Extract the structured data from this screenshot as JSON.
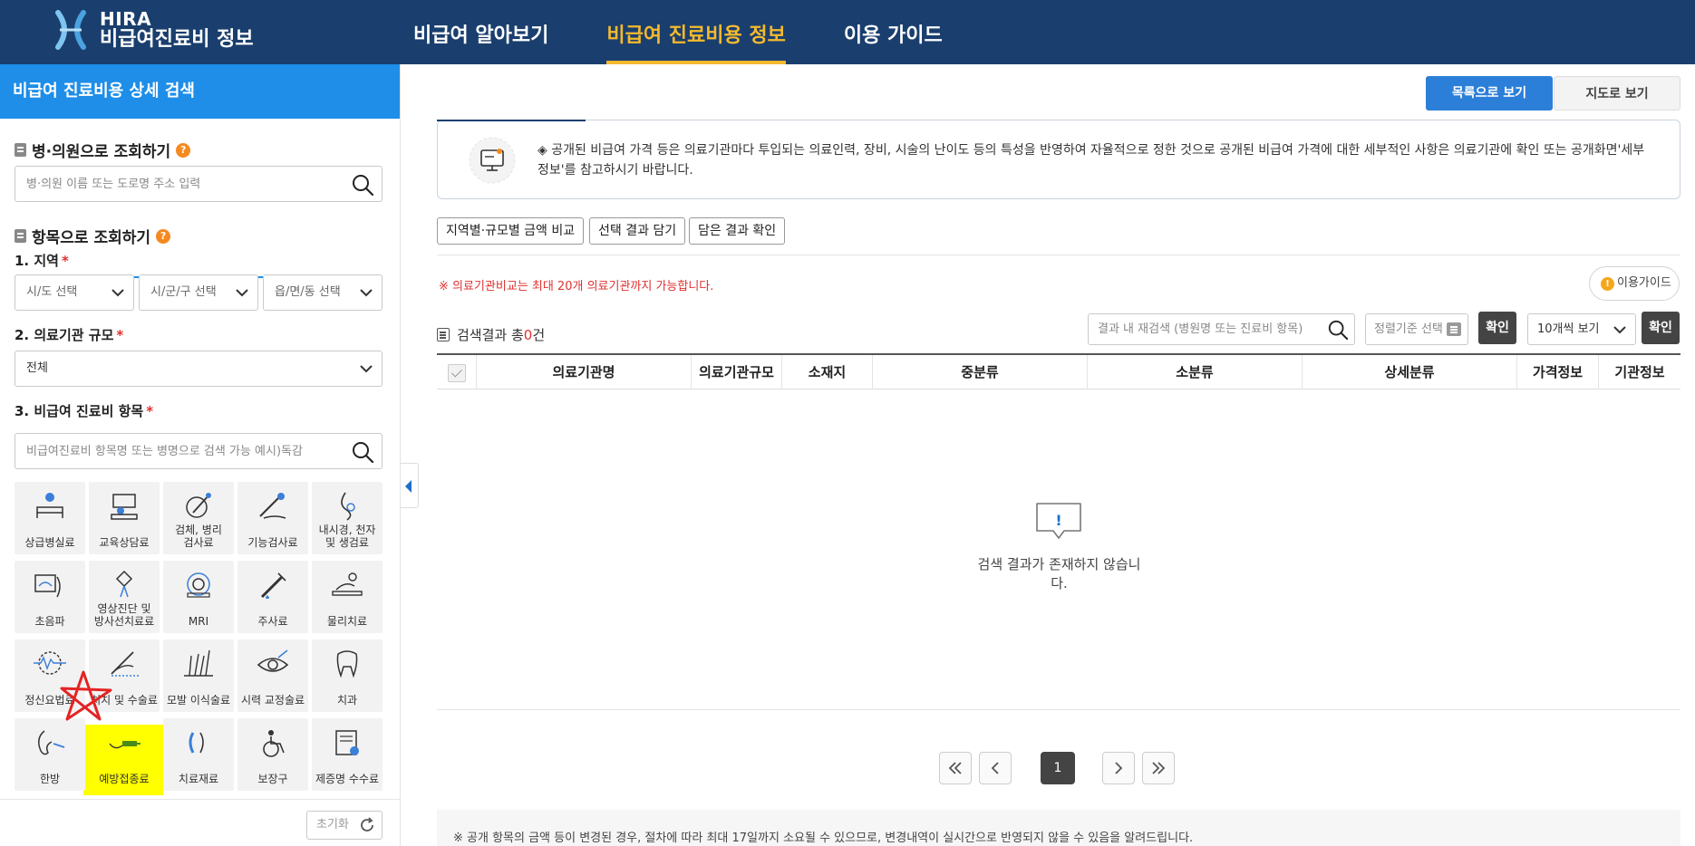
{
  "header": {
    "logo_en": "HIRA",
    "logo_ko": "비급여진료비 정보",
    "nav": [
      {
        "label": "비급여 알아보기",
        "active": false
      },
      {
        "label": "비급여 진료비용 정보",
        "active": true
      },
      {
        "label": "이용 가이드",
        "active": false
      }
    ]
  },
  "sidebar": {
    "title": "비급여 진료비용 상세 검색",
    "hospital_search": {
      "heading": "병·의원으로 조회하기",
      "help": "?",
      "placeholder": "병·의원 이름 또는 도로명 주소 입력"
    },
    "item_search": {
      "heading": "항목으로 조회하기",
      "help": "?",
      "region_label": "1. 지역",
      "region_selects": [
        "시/도 선택",
        "시/군/구 선택",
        "읍/면/동 선택"
      ],
      "scale_label": "2. 의료기관 규모",
      "scale_value": "전체",
      "item_label": "3. 비급여 진료비 항목",
      "item_placeholder": "비급여진료비 항목명 또는 병명으로 검색 가능 예시)독감",
      "required_mark": "*"
    },
    "categories": [
      {
        "label": "상급병실료",
        "icon": "hospital-bed-icon"
      },
      {
        "label": "교육상담료",
        "icon": "counseling-icon"
      },
      {
        "label": "검체, 병리\n검사료",
        "icon": "specimen-test-icon"
      },
      {
        "label": "기능검사료",
        "icon": "function-test-icon"
      },
      {
        "label": "내시경, 천자\n및 생검료",
        "icon": "endoscope-icon"
      },
      {
        "label": "초음파",
        "icon": "ultrasound-icon"
      },
      {
        "label": "영상진단 및\n방사선치료료",
        "icon": "radiology-icon"
      },
      {
        "label": "MRI",
        "icon": "mri-icon"
      },
      {
        "label": "주사료",
        "icon": "injection-icon"
      },
      {
        "label": "물리치료",
        "icon": "physical-therapy-icon"
      },
      {
        "label": "정신요법료",
        "icon": "psychotherapy-icon"
      },
      {
        "label": "처치 및 수술료",
        "icon": "surgery-icon"
      },
      {
        "label": "모발 이식술료",
        "icon": "hair-transplant-icon"
      },
      {
        "label": "시력 교정술료",
        "icon": "eye-correction-icon"
      },
      {
        "label": "치과",
        "icon": "tooth-icon"
      },
      {
        "label": "한방",
        "icon": "oriental-medicine-icon"
      },
      {
        "label": "예방접종료",
        "icon": "vaccination-icon"
      },
      {
        "label": "치료재료",
        "icon": "treatment-material-icon"
      },
      {
        "label": "보장구",
        "icon": "wheelchair-icon"
      },
      {
        "label": "제증명 수수료",
        "icon": "certificate-icon"
      }
    ],
    "reset_label": "초기화"
  },
  "main": {
    "view_list": "목록으로 보기",
    "view_map": "지도로 보기",
    "notice": "◈ 공개된 비급여 가격 등은 의료기관마다 투입되는 의료인력, 장비, 시술의 난이도 등의 특성을 반영하여 자율적으로 정한 것으로 공개된 비급여 가격에 대한 세부적인 사항은 의료기관에 확인 또는 공개화면'세부정보'를 참고하시기 바랍니다.",
    "actions": [
      "지역별·규모별 금액 비교",
      "선택 결과 담기",
      "담은 결과 확인"
    ],
    "warning": "※ 의료기관비교는 최대 20개 의료기관까지 가능합니다.",
    "guide_label": "이용가이드",
    "result_prefix": "검색결과 총",
    "result_count": "0",
    "result_suffix": "건",
    "re_search_placeholder": "결과 내 재검색 (병원명 또는 진료비 항목)",
    "sort_placeholder": "정렬기준 선택",
    "confirm_label": "확인",
    "page_size": "10개씩 보기",
    "columns": [
      "의료기관명",
      "의료기관규모",
      "소재지",
      "중분류",
      "소분류",
      "상세분류",
      "가격정보",
      "기관정보"
    ],
    "empty_message": "검색 결과가 존재하지 않습니다.",
    "empty_icon_text": "!",
    "current_page": "1",
    "footnote": "※ 공개 항목의 금액 등이 변경된 경우, 절차에 따라 최대 17일까지 소요될 수 있으므로, 변경내역이 실시간으로 반영되지 않을 수 있음을 알려드립니다."
  },
  "colors": {
    "header_bg": "#1a3f6e",
    "accent_yellow": "#f5b92e",
    "sidebar_title_bg": "#1e8ee8",
    "primary_button": "#2c7fd8",
    "required_red": "#e0302f"
  }
}
